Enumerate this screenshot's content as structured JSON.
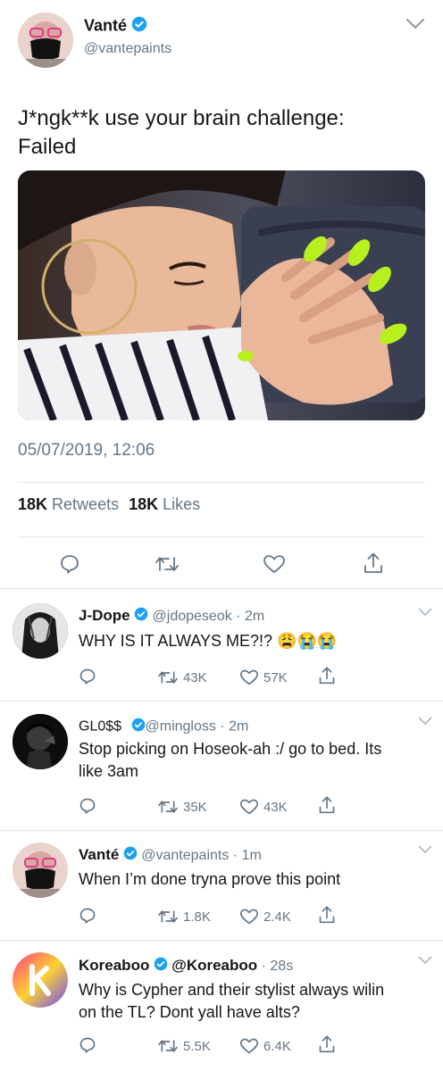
{
  "main_tweet": {
    "author_name": "Vanté",
    "author_handle": "@vantepaints",
    "text_line1": "J*ngk**k use your brain challenge:",
    "text_line2": "Failed",
    "timestamp": "05/07/2019, 12:06",
    "retweets_count": "18K",
    "retweets_label": "Retweets",
    "likes_count": "18K",
    "likes_label": "Likes"
  },
  "replies": [
    {
      "name": "J-Dope",
      "handle": "@jdopeseok",
      "time": "· 2m",
      "text": "WHY IS IT ALWAYS ME?!?",
      "emoji": "😩😭😭",
      "retweets": "43K",
      "likes": "57K"
    },
    {
      "name": "GL0$$",
      "handle": "@mingloss",
      "time": "· 2m",
      "text_line1": "Stop picking on Hoseok-ah :/ go to bed. Its",
      "text_line2": "like 3am",
      "retweets": "35K",
      "likes": "43K"
    },
    {
      "name": "Vanté",
      "handle": "@vantepaints",
      "time": "· 1m",
      "text": "When I’m done tryna prove this point",
      "retweets": "1.8K",
      "likes": "2.4K"
    },
    {
      "name": "Koreaboo",
      "handle": "@Koreaboo",
      "time": "· 28s",
      "text_line1": "Why is Cypher and their stylist always wilin",
      "text_line2": "on the TL? Dont yall have alts?",
      "retweets": "5.5K",
      "likes": "6.4K"
    }
  ],
  "colors": {
    "verified_blue": "#1da1f2",
    "muted_text": "#657786",
    "divider": "#e1e8ed"
  },
  "icons": [
    "verified-badge-icon",
    "chevron-down-icon",
    "reply-icon",
    "retweet-icon",
    "like-icon",
    "share-icon"
  ]
}
